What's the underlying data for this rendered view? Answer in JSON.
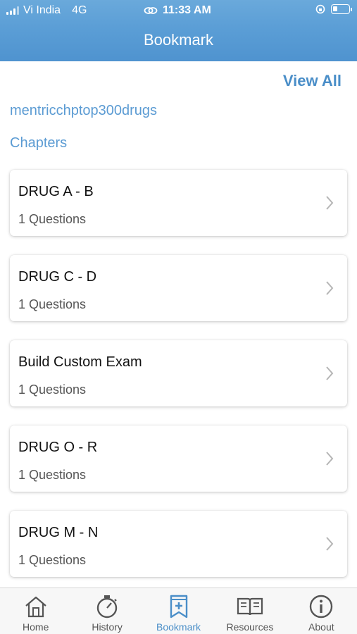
{
  "status_bar": {
    "carrier": "Vi India",
    "network": "4G",
    "time": "11:33 AM"
  },
  "header": {
    "title": "Bookmark"
  },
  "view_all_label": "View All",
  "course_name": "mentricchptop300drugs",
  "section_label": "Chapters",
  "chapters": [
    {
      "title": "DRUG A - B",
      "count": "1 Questions"
    },
    {
      "title": "DRUG C - D",
      "count": "1 Questions"
    },
    {
      "title": "Build Custom Exam",
      "count": "1 Questions"
    },
    {
      "title": "DRUG O - R",
      "count": "1 Questions"
    },
    {
      "title": "DRUG M - N",
      "count": "1 Questions"
    }
  ],
  "tabs": [
    {
      "label": "Home",
      "icon": "home-icon"
    },
    {
      "label": "History",
      "icon": "stopwatch-icon"
    },
    {
      "label": "Bookmark",
      "icon": "bookmark-icon",
      "active": true
    },
    {
      "label": "Resources",
      "icon": "book-icon"
    },
    {
      "label": "About",
      "icon": "info-icon"
    }
  ],
  "colors": {
    "accent": "#4a8ec8",
    "header": "#5b9ed6"
  }
}
